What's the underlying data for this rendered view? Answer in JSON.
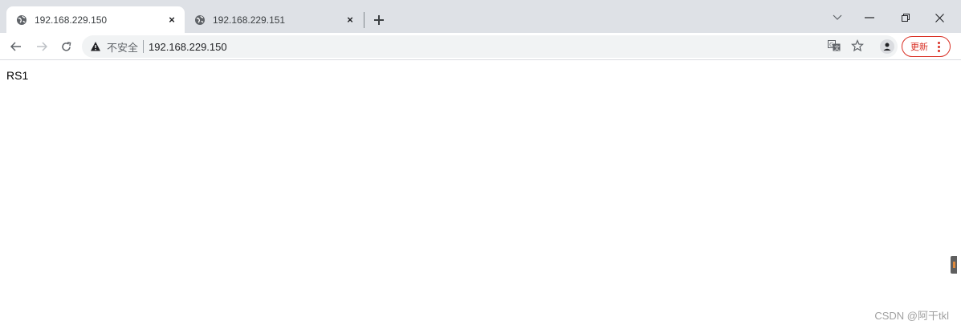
{
  "tabs": [
    {
      "title": "192.168.229.150",
      "active": true,
      "icon": "globe-icon",
      "close": "×"
    },
    {
      "title": "192.168.229.151",
      "active": false,
      "icon": "globe-icon",
      "close": "×"
    }
  ],
  "newtab_glyph": "+",
  "window_controls": {
    "dropdown": "⌵",
    "minimize": "−",
    "restore": "❐",
    "close": "✕"
  },
  "toolbar": {
    "back": "←",
    "forward": "→",
    "reload": "C",
    "insecure_label": "不安全",
    "url": "192.168.229.150",
    "translate_icon": "translate-icon",
    "bookmark": "☆",
    "update_label": "更新"
  },
  "page": {
    "body_text": "RS1",
    "watermark": "CSDN @阿干tkl"
  },
  "colors": {
    "tabstrip": "#dee1e6",
    "omnibox": "#f1f3f4",
    "update_accent": "#d93025"
  }
}
